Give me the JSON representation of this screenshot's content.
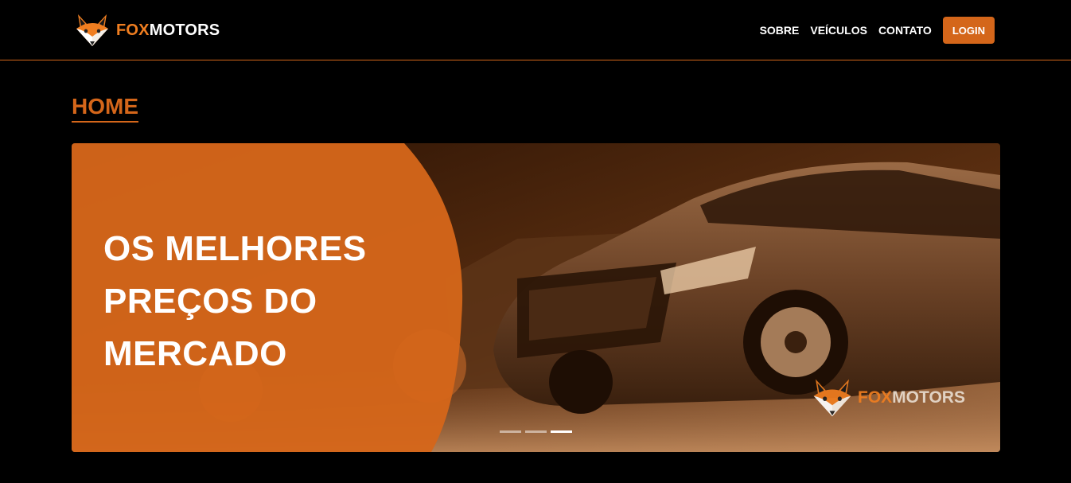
{
  "brand": {
    "fox": "FOX",
    "motors": "MOTORS"
  },
  "nav": {
    "items": [
      {
        "label": "SOBRE"
      },
      {
        "label": "VEÍCULOS"
      },
      {
        "label": "CONTATO"
      }
    ],
    "login_label": "LOGIN"
  },
  "page": {
    "title": "HOME"
  },
  "hero": {
    "lines": [
      "OS MELHORES",
      "PREÇOS DO",
      "MERCADO"
    ],
    "watermark": {
      "fox": "FOX",
      "motors": "MOTORS"
    },
    "slides": {
      "count": 3,
      "active_index": 2
    }
  },
  "colors": {
    "accent": "#d4661a",
    "background": "#000000",
    "text": "#ffffff"
  }
}
